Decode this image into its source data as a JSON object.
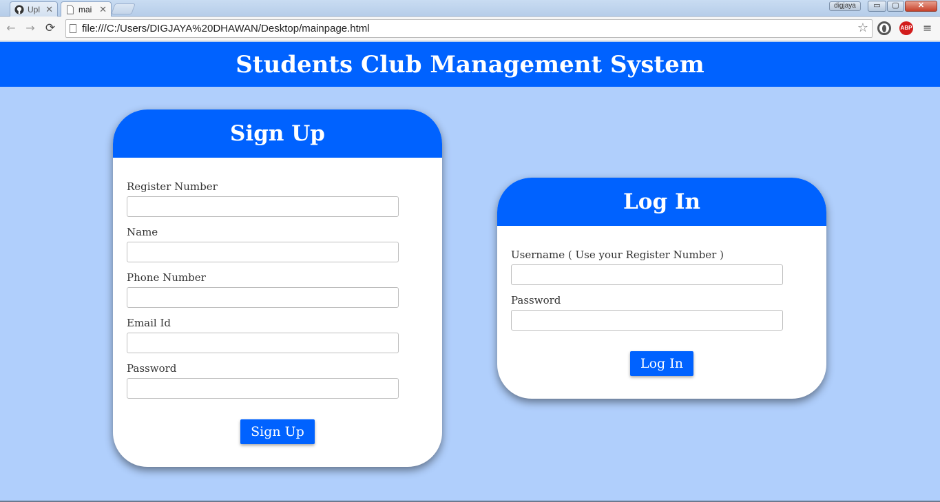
{
  "browser": {
    "tabs": [
      {
        "title": "Upl",
        "icon": "github-icon"
      },
      {
        "title": "mai",
        "icon": "page-icon"
      }
    ],
    "user_button": "digjaya",
    "window_controls": {
      "minimize": "▭",
      "maximize": "▢",
      "close": "✕"
    },
    "url": "file:///C:/Users/DIGJAYA%20DHAWAN/Desktop/mainpage.html",
    "abp_label": "ABP"
  },
  "page": {
    "title": "Students Club Management System",
    "signup": {
      "heading": "Sign Up",
      "fields": [
        {
          "label": "Register Number",
          "value": ""
        },
        {
          "label": "Name",
          "value": ""
        },
        {
          "label": "Phone Number",
          "value": ""
        },
        {
          "label": "Email Id",
          "value": ""
        },
        {
          "label": "Password",
          "value": ""
        }
      ],
      "button": "Sign Up"
    },
    "login": {
      "heading": "Log In",
      "fields": [
        {
          "label": "Username ( Use your Register Number )",
          "value": ""
        },
        {
          "label": "Password",
          "value": ""
        }
      ],
      "button": "Log In"
    }
  },
  "colors": {
    "primary": "#0062ff",
    "background": "#b0cffc",
    "card": "#ffffff"
  }
}
